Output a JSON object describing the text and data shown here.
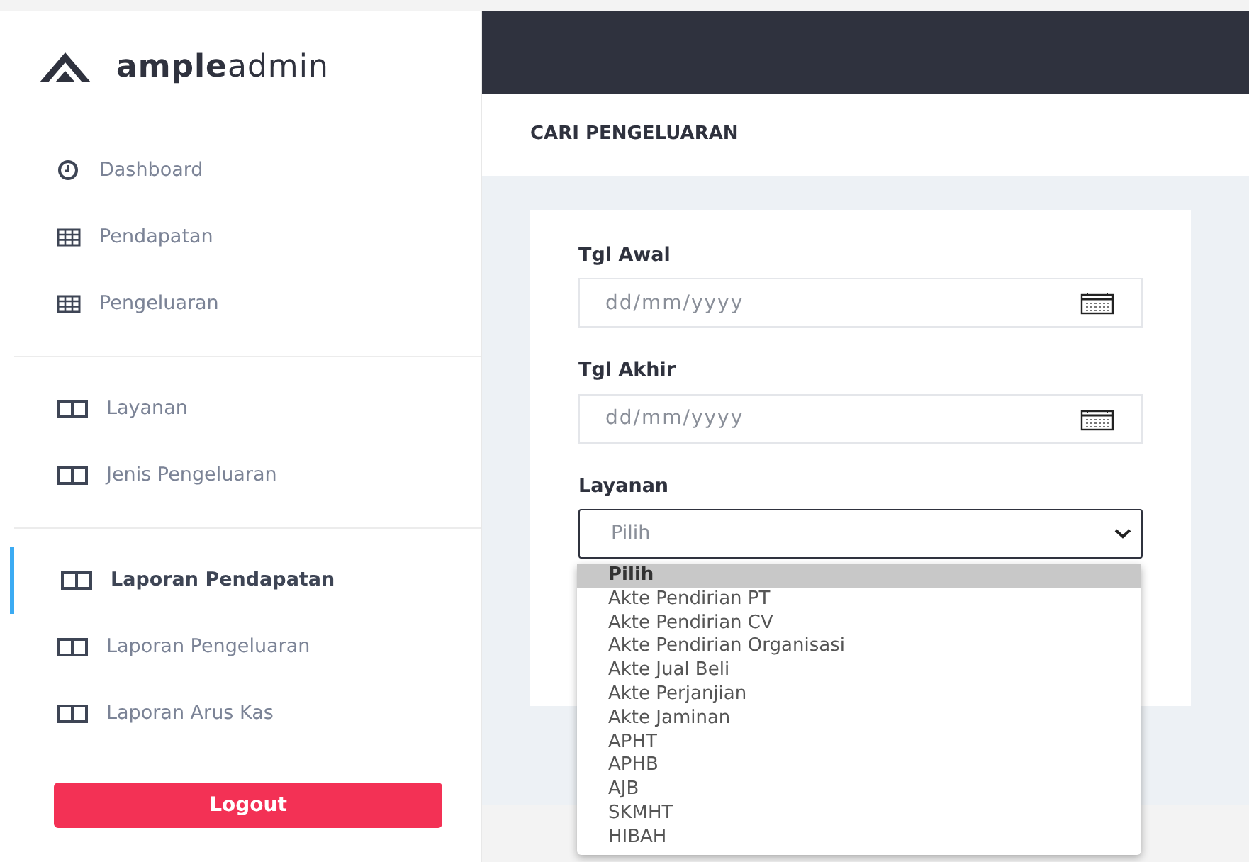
{
  "logo": {
    "text": "**ample**admin"
  },
  "sidebar": {
    "groups": [
      {
        "items": [
          {
            "label": "Dashboard",
            "kind": "clock",
            "selected": false
          },
          {
            "label": "Pendapatan",
            "kind": "table",
            "selected": false
          },
          {
            "label": "Pengeluaran",
            "kind": "table",
            "selected": false
          }
        ]
      },
      {
        "items": [
          {
            "label": "Layanan",
            "kind": "columns",
            "selected": false
          },
          {
            "label": "Jenis Pengeluaran",
            "kind": "columns",
            "selected": false
          }
        ]
      },
      {
        "items": [
          {
            "label": "Laporan Pendapatan",
            "kind": "columns",
            "selected": true
          },
          {
            "label": "Laporan Pengeluaran",
            "kind": "columns",
            "selected": false
          },
          {
            "label": "Laporan Arus Kas",
            "kind": "columns",
            "selected": false
          }
        ]
      }
    ],
    "logout": "Logout"
  },
  "page_title": "CARI PENGELUARAN",
  "form": {
    "fields": [
      {
        "kind": "date",
        "label": "Tgl Awal",
        "placeholder": "dd/mm/yyyy"
      },
      {
        "kind": "date",
        "label": "Tgl Akhir",
        "placeholder": "dd/mm/yyyy"
      },
      {
        "kind": "select",
        "label": "Layanan",
        "value": "Pilih",
        "expanded": true,
        "options": [
          {
            "label": "Pilih",
            "selected": true
          },
          {
            "label": "Akte Pendirian PT",
            "selected": false
          },
          {
            "label": "Akte Pendirian CV",
            "selected": false
          },
          {
            "label": "Akte Pendirian Organisasi",
            "selected": false
          },
          {
            "label": "Akte Jual Beli",
            "selected": false
          },
          {
            "label": "Akte Perjanjian",
            "selected": false
          },
          {
            "label": "Akte Jaminan",
            "selected": false
          },
          {
            "label": "APHT",
            "selected": false
          },
          {
            "label": "APHB",
            "selected": false
          },
          {
            "label": "AJB",
            "selected": false
          },
          {
            "label": "SKMHT",
            "selected": false
          },
          {
            "label": "HIBAH",
            "selected": false
          }
        ]
      }
    ]
  }
}
